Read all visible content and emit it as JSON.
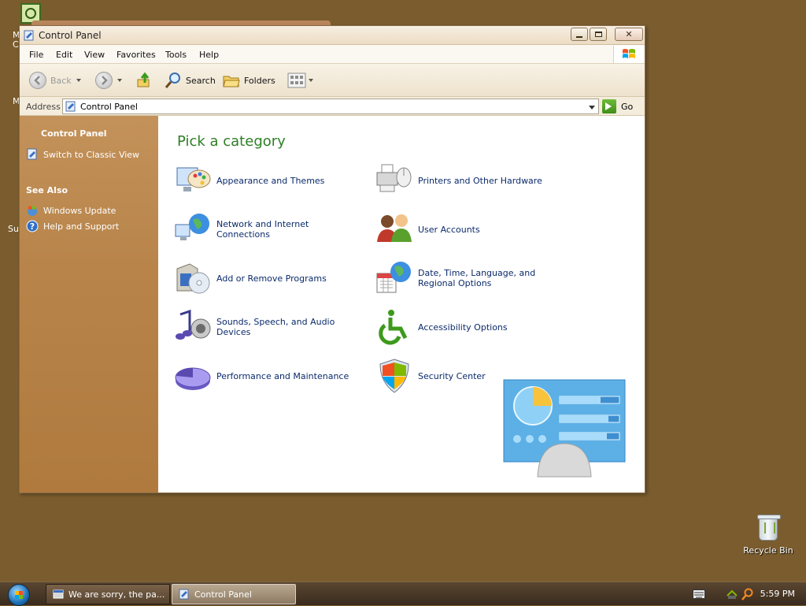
{
  "desktop": {
    "fragments": [
      "M",
      "C",
      "M",
      "Su"
    ],
    "recycle_bin_label": "Recycle Bin"
  },
  "window": {
    "title": "Control Panel",
    "menu": [
      "File",
      "Edit",
      "View",
      "Favorites",
      "Tools",
      "Help"
    ],
    "toolbar": {
      "back": "Back",
      "search": "Search",
      "folders": "Folders"
    },
    "address": {
      "label": "Address",
      "value": "Control Panel",
      "go": "Go"
    },
    "sidebar": {
      "title": "Control Panel",
      "switch_view": "Switch to Classic View",
      "see_also": "See Also",
      "windows_update": "Windows Update",
      "help_support": "Help and Support"
    },
    "content": {
      "heading": "Pick a category",
      "categories": [
        "Appearance and Themes",
        "Printers and Other Hardware",
        "Network and Internet Connections",
        "User Accounts",
        "Add or Remove Programs",
        "Date, Time, Language, and Regional Options",
        "Sounds, Speech, and Audio Devices",
        "Accessibility Options",
        "Performance and Maintenance",
        "Security Center"
      ]
    }
  },
  "taskbar": {
    "tasks": [
      "We are sorry, the pa...",
      "Control Panel"
    ],
    "clock": "5:59 PM"
  },
  "colors": {
    "desktop": "#7a5c2e",
    "sidebar": "#b8844a",
    "heading_green": "#2d7f24",
    "link_blue": "#0b2a6b"
  }
}
